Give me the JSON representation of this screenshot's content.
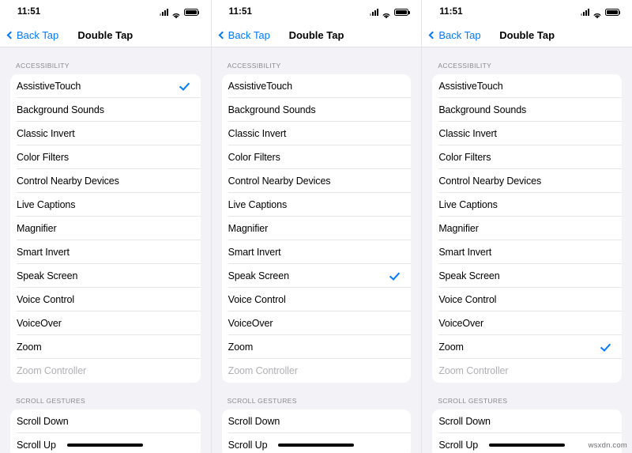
{
  "colors": {
    "accent": "#007aff",
    "background": "#f2f2f7",
    "card": "#ffffff",
    "separator": "#e6e6e9",
    "label": "#000000",
    "secondary_label": "#8a8a8e",
    "disabled_label": "#b0b0b5"
  },
  "watermark": "wsxdn.com",
  "status_bar": {
    "time": "11:51",
    "icons": [
      "cellular-signal-icon",
      "wifi-icon",
      "battery-icon"
    ]
  },
  "nav": {
    "back_label": "Back Tap",
    "back_icon": "chevron-left-icon",
    "title": "Double Tap"
  },
  "sections": [
    {
      "header": "ACCESSIBILITY",
      "items": [
        "AssistiveTouch",
        "Background Sounds",
        "Classic Invert",
        "Color Filters",
        "Control Nearby Devices",
        "Live Captions",
        "Magnifier",
        "Smart Invert",
        "Speak Screen",
        "Voice Control",
        "VoiceOver",
        "Zoom",
        "Zoom Controller"
      ],
      "disabled_items": [
        "Zoom Controller"
      ]
    },
    {
      "header": "SCROLL GESTURES",
      "items": [
        "Scroll Down",
        "Scroll Up"
      ],
      "disabled_items": []
    }
  ],
  "panels": [
    {
      "id": "panel-1",
      "selected": "AssistiveTouch"
    },
    {
      "id": "panel-2",
      "selected": "Speak Screen"
    },
    {
      "id": "panel-3",
      "selected": "Zoom"
    }
  ]
}
